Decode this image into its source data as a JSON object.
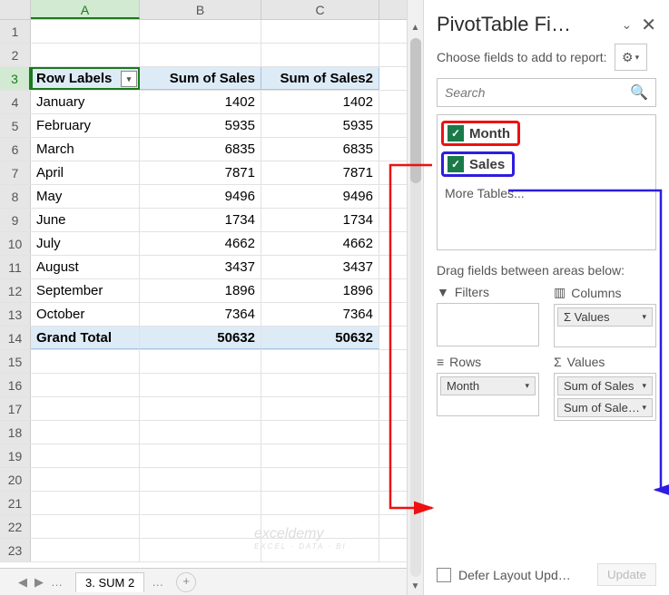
{
  "pane": {
    "title": "PivotTable Fi…",
    "subtitle": "Choose fields to add to report:",
    "search_placeholder": "Search",
    "fields": {
      "month": "Month",
      "sales": "Sales",
      "more": "More Tables..."
    },
    "drag_label": "Drag fields between areas below:",
    "filters_label": "Filters",
    "columns_label": "Columns",
    "rows_label": "Rows",
    "values_label": "Values",
    "col_pill": "Values",
    "row_pill": "Month",
    "val_pill1": "Sum of Sales",
    "val_pill2": "Sum of Sale…",
    "defer_label": "Defer Layout Upd…",
    "update_btn": "Update"
  },
  "sheet": {
    "cols": [
      "A",
      "B",
      "C"
    ],
    "header": {
      "a": "Row Labels",
      "b": "Sum of Sales",
      "c": "Sum of Sales2"
    },
    "rows": [
      {
        "m": "January",
        "s1": "1402",
        "s2": "1402"
      },
      {
        "m": "February",
        "s1": "5935",
        "s2": "5935"
      },
      {
        "m": "March",
        "s1": "6835",
        "s2": "6835"
      },
      {
        "m": "April",
        "s1": "7871",
        "s2": "7871"
      },
      {
        "m": "May",
        "s1": "9496",
        "s2": "9496"
      },
      {
        "m": "June",
        "s1": "1734",
        "s2": "1734"
      },
      {
        "m": "July",
        "s1": "4662",
        "s2": "4662"
      },
      {
        "m": "August",
        "s1": "3437",
        "s2": "3437"
      },
      {
        "m": "September",
        "s1": "1896",
        "s2": "1896"
      },
      {
        "m": "October",
        "s1": "7364",
        "s2": "7364"
      }
    ],
    "grand": {
      "label": "Grand Total",
      "s1": "50632",
      "s2": "50632"
    },
    "tab": "3. SUM 2",
    "plus": "+"
  },
  "chart_data": {
    "type": "table",
    "categories": [
      "January",
      "February",
      "March",
      "April",
      "May",
      "June",
      "July",
      "August",
      "September",
      "October"
    ],
    "series": [
      {
        "name": "Sum of Sales",
        "values": [
          1402,
          5935,
          6835,
          7871,
          9496,
          1734,
          4662,
          3437,
          1896,
          7364
        ]
      },
      {
        "name": "Sum of Sales2",
        "values": [
          1402,
          5935,
          6835,
          7871,
          9496,
          1734,
          4662,
          3437,
          1896,
          7364
        ]
      }
    ],
    "totals": {
      "Sum of Sales": 50632,
      "Sum of Sales2": 50632
    }
  }
}
